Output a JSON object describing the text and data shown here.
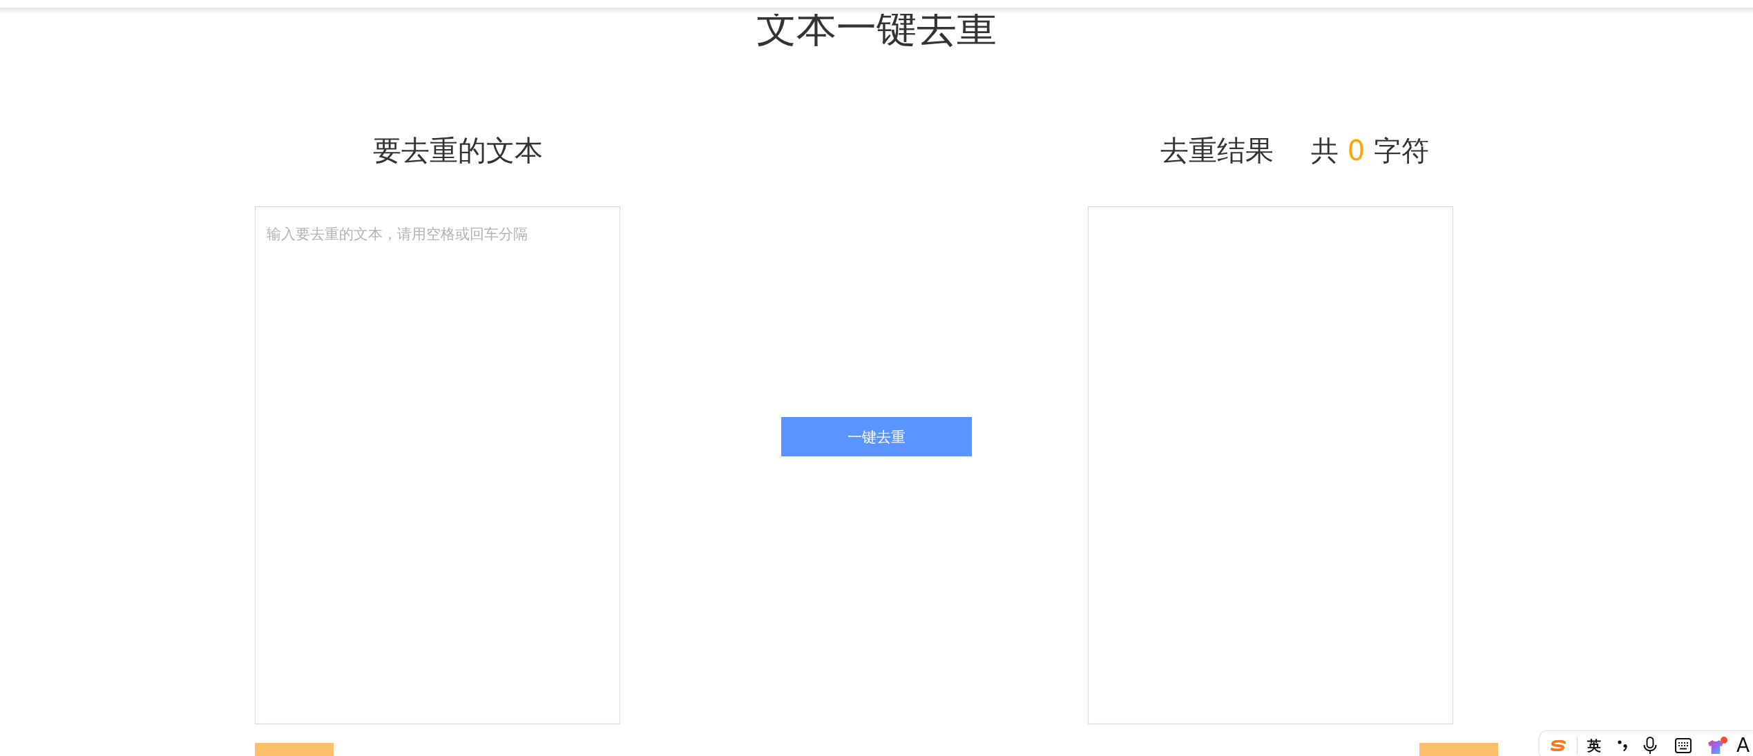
{
  "title": "文本一键去重",
  "source": {
    "heading": "要去重的文本",
    "input": {
      "placeholder": "输入要去重的文本，请用空格或回车分隔"
    }
  },
  "action": {
    "label": "一键去重"
  },
  "result": {
    "heading": "去重结果",
    "count": {
      "prefix": "共",
      "value": "0",
      "suffix": "字符"
    }
  },
  "ime_toolbar": {
    "mode": "英",
    "ai_label": "A"
  }
}
